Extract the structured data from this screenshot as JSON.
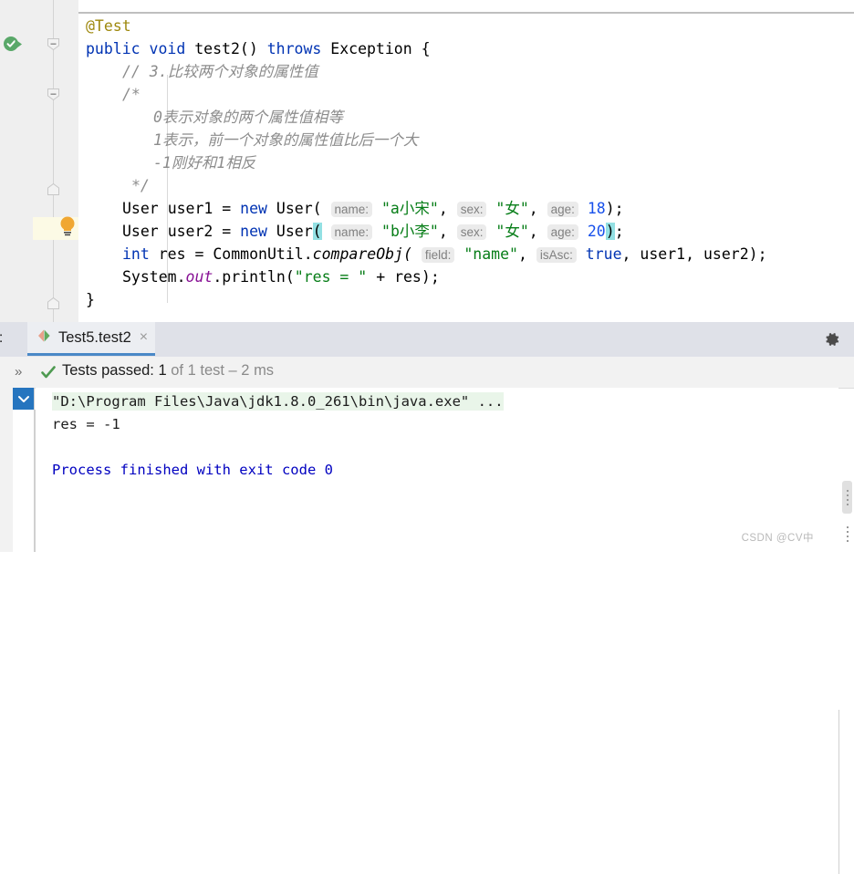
{
  "editor": {
    "code_lines": [
      {
        "indent": 0,
        "text": "@Test"
      },
      {
        "indent": 0,
        "text": "public void test2() throws Exception {"
      },
      {
        "indent": 1,
        "text": "// 3.比较两个对象的属性值"
      },
      {
        "indent": 1,
        "text": "/*"
      },
      {
        "indent": 2,
        "text": "0表示对象的两个属性值相等"
      },
      {
        "indent": 2,
        "text": "1表示，前一个对象的属性值比后一个大"
      },
      {
        "indent": 2,
        "text": "-1刚好和1相反"
      },
      {
        "indent": 1,
        "text": "*/"
      },
      {
        "indent": 1,
        "text": "User user1 = new User( name: \"a小宋\", sex: \"女\", age: 18);"
      },
      {
        "indent": 1,
        "text": "User user2 = new User( name: \"b小李\", sex: \"女\", age: 20);"
      },
      {
        "indent": 1,
        "text": "int res = CommonUtil.compareObj( field: \"name\", isAsc: true, user1, user2);"
      },
      {
        "indent": 1,
        "text": "System.out.println(\"res = \" + res);"
      },
      {
        "indent": 0,
        "text": "}"
      }
    ],
    "tokens": {
      "annotation_test": "@Test",
      "kw_public": "public",
      "kw_void": "void",
      "method_name": "test2()",
      "kw_throws": "throws",
      "type_exception": "Exception",
      "brace_open": "{",
      "brace_close": "}",
      "comment_line": "// 3.比较两个对象的属性值",
      "comment_open": "/*",
      "comment_close": "*/",
      "comment_body_1": "0表示对象的两个属性值相等",
      "comment_body_2": "1表示，前一个对象的属性值比后一个大",
      "comment_body_3": "-1刚好和1相反",
      "type_user": "User",
      "var_user1": "user1",
      "var_user2": "user2",
      "kw_new": "new",
      "ctor_user": "User(",
      "hint_name": "name:",
      "hint_sex": "sex:",
      "hint_age": "age:",
      "hint_field": "field:",
      "hint_isAsc": "isAsc:",
      "str_a": "\"a小宋\"",
      "str_b": "\"b小李\"",
      "str_sex": "\"女\"",
      "str_name": "\"name\"",
      "num_18": "18",
      "num_20": "20",
      "kw_int": "int",
      "var_res": "res",
      "class_commonutil": "CommonUtil.",
      "method_compareobj": "compareObj(",
      "kw_true": "true",
      "system_out": "System.",
      "field_out": "out",
      "method_println": ".println(",
      "str_res_eq": "\"res = \"",
      "plus": "+",
      "eq": "=",
      "comma": ",",
      "semicolon": ";",
      "close_paren": ")"
    },
    "gutter": {
      "run_test_icon": "run-test-passed-icon",
      "lightbulb_icon": "intention-bulb-icon",
      "fold_icons": [
        "fold-collapse-icon",
        "fold-collapse-icon",
        "fold-end-icon",
        "fold-end-icon"
      ]
    }
  },
  "run_window": {
    "title": "n:",
    "tab": {
      "icon": "junit-test-icon",
      "label": "Test5.test2",
      "close": "×"
    },
    "gear_icon": "gear-icon",
    "expand_chevrons": "»",
    "status": {
      "check_icon": "check-icon",
      "prefix": "Tests passed: ",
      "count": "1",
      "suffix": " of 1 test – 2 ms"
    },
    "collapse_icon": "chevron-down-icon",
    "console": {
      "command": "\"D:\\Program Files\\Java\\jdk1.8.0_261\\bin\\java.exe\" ...",
      "output": "res = -1",
      "finished": "Process finished with exit code 0"
    }
  },
  "watermark": "CSDN @CV中",
  "colors": {
    "keyword": "#0033b3",
    "string": "#067d17",
    "number": "#1750eb",
    "comment": "#8c8c8c",
    "annotation": "#9e880d",
    "field": "#871094",
    "tab_underline": "#4a88c7",
    "current_line": "#fcfae5",
    "paren_match": "#93e0e3",
    "console_cmd_bg": "#e9f5e9",
    "console_blue": "#0000c0",
    "success_green": "#59a869",
    "bulb_orange": "#f5a623"
  }
}
